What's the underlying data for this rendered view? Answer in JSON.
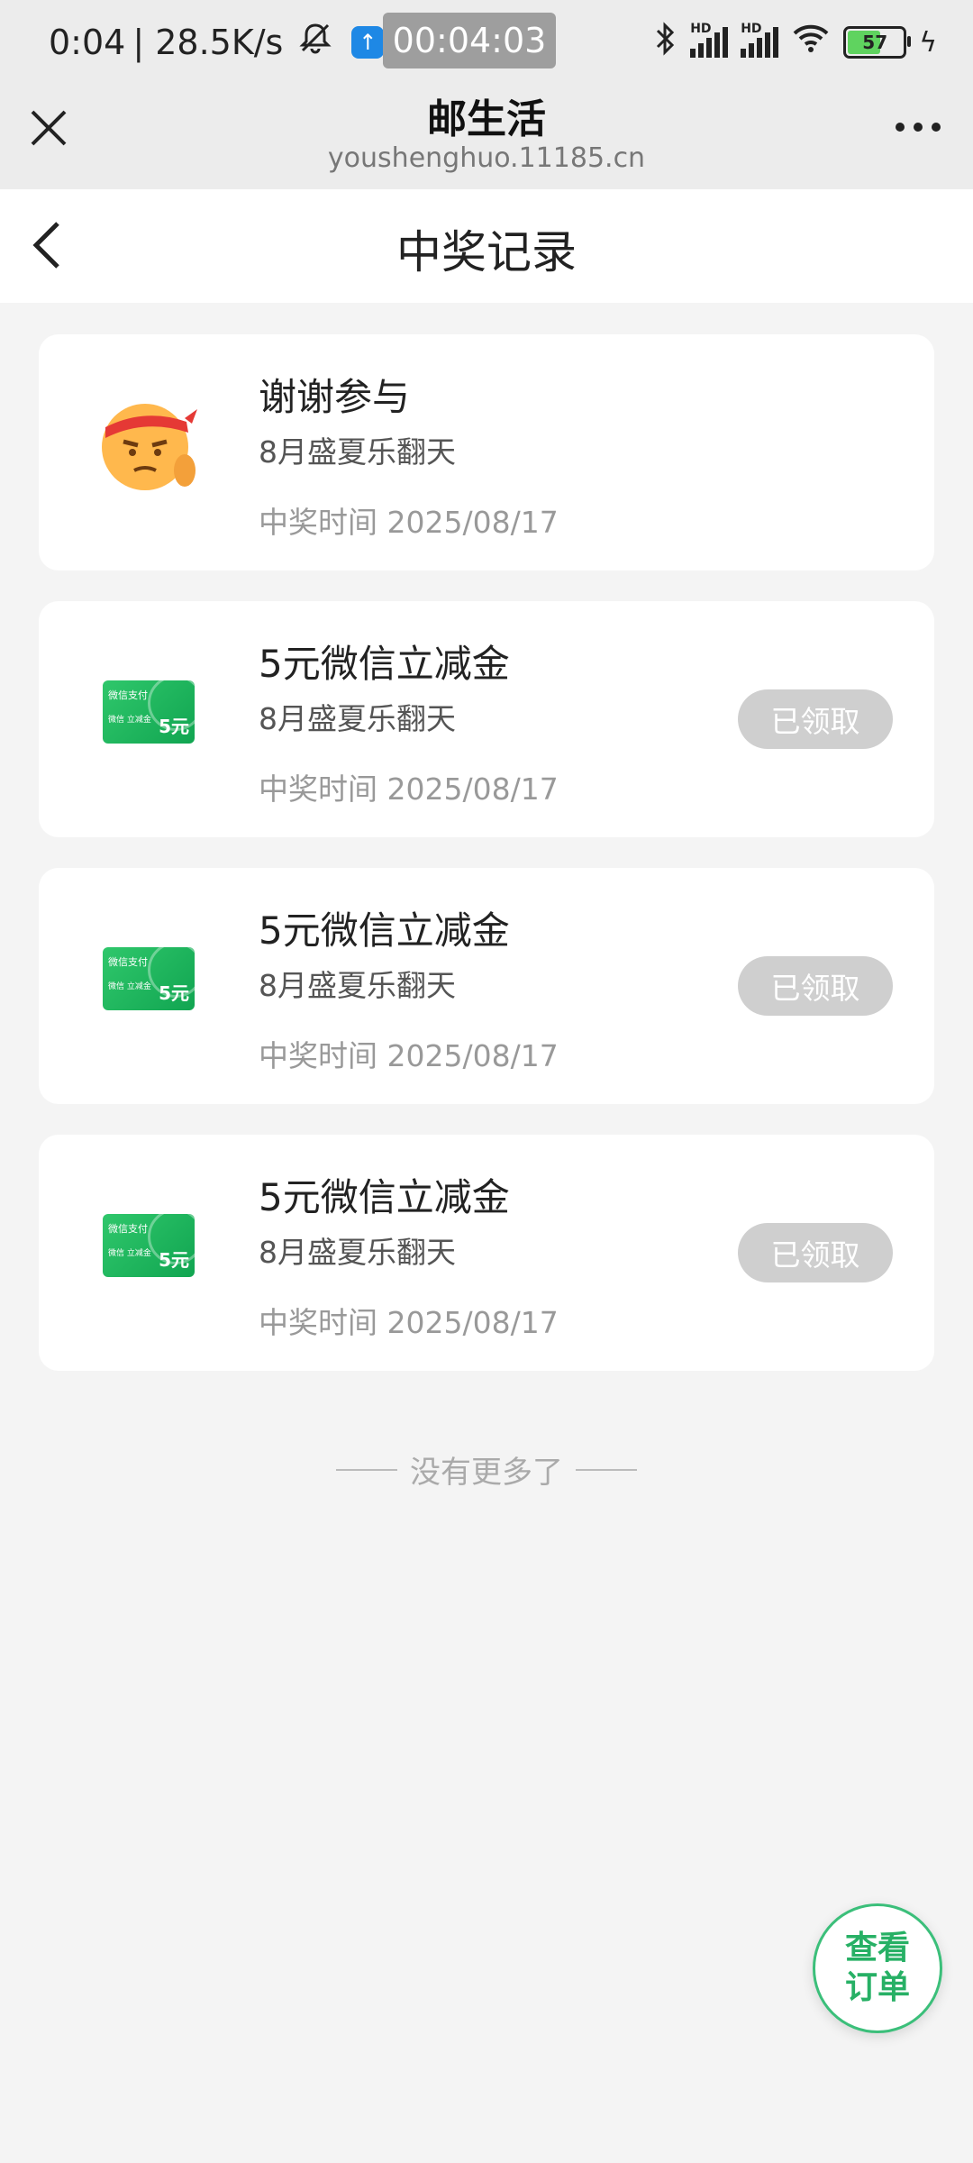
{
  "status_bar": {
    "time": "0:04",
    "speed": "| 28.5K/s",
    "timer": "00:04:03",
    "hd1": "HD",
    "hd2": "HD",
    "battery": "57"
  },
  "browser": {
    "title": "邮生活",
    "url": "youshenghuo.11185.cn"
  },
  "page": {
    "title": "中奖记录"
  },
  "records": [
    {
      "name": "谢谢参与",
      "activity": "8月盛夏乐翻天",
      "time": "中奖时间 2025/08/17",
      "thumb": "emoji-face",
      "status": ""
    },
    {
      "name": "5元微信立减金",
      "activity": "8月盛夏乐翻天",
      "time": "中奖时间 2025/08/17",
      "thumb": "wechat-voucher",
      "status": "已领取"
    },
    {
      "name": "5元微信立减金",
      "activity": "8月盛夏乐翻天",
      "time": "中奖时间 2025/08/17",
      "thumb": "wechat-voucher",
      "status": "已领取"
    },
    {
      "name": "5元微信立减金",
      "activity": "8月盛夏乐翻天",
      "time": "中奖时间 2025/08/17",
      "thumb": "wechat-voucher",
      "status": "已领取"
    }
  ],
  "voucher_art": {
    "pay": "微信支付",
    "label": "微信\n立减金",
    "amount": "5元"
  },
  "footer": {
    "no_more": "没有更多了"
  },
  "fab": {
    "label": "查看订单"
  },
  "colors": {
    "accent": "#27b065",
    "claimed_bg": "#cfcfcf",
    "page_bg": "#f4f4f4"
  }
}
